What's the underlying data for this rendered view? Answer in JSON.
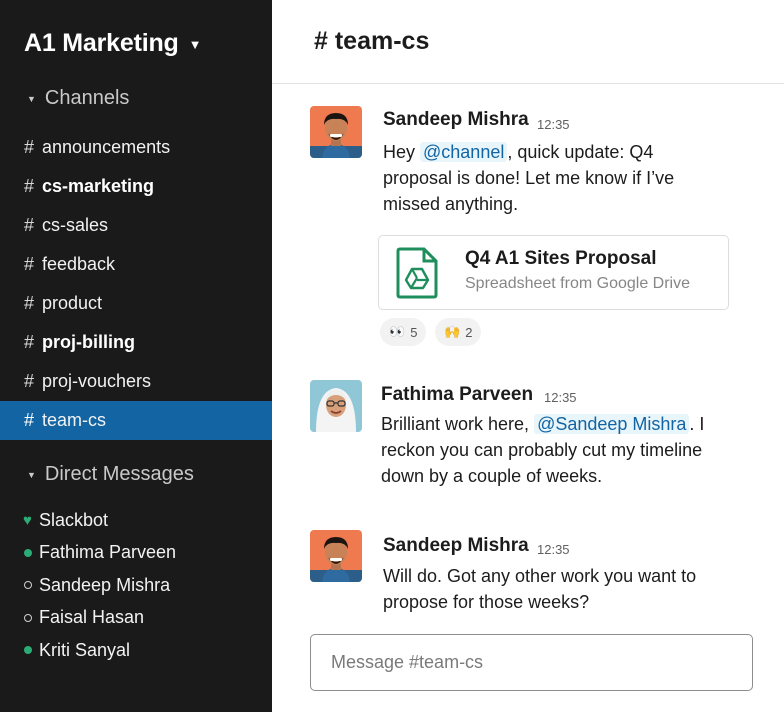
{
  "workspace": {
    "name": "A1 Marketing",
    "caret": "▼"
  },
  "sidebar": {
    "channels_heading": "Channels",
    "channels": [
      {
        "name": "announcements",
        "bold": false,
        "active": false
      },
      {
        "name": "cs-marketing",
        "bold": true,
        "active": false
      },
      {
        "name": "cs-sales",
        "bold": false,
        "active": false
      },
      {
        "name": "feedback",
        "bold": false,
        "active": false
      },
      {
        "name": "product",
        "bold": false,
        "active": false
      },
      {
        "name": "proj-billing",
        "bold": true,
        "active": false
      },
      {
        "name": "proj-vouchers",
        "bold": false,
        "active": false
      },
      {
        "name": "team-cs",
        "bold": false,
        "active": true
      }
    ],
    "dms_heading": "Direct Messages",
    "dms": [
      {
        "name": "Slackbot",
        "presence": "heart"
      },
      {
        "name": "Fathima Parveen",
        "presence": "online"
      },
      {
        "name": "Sandeep Mishra",
        "presence": "away"
      },
      {
        "name": "Faisal Hasan",
        "presence": "away"
      },
      {
        "name": "Kriti Sanyal",
        "presence": "online"
      }
    ]
  },
  "header": {
    "hash": "#",
    "channel": "team-cs"
  },
  "messages": [
    {
      "author": "Sandeep Mishra",
      "time": "12:35",
      "text_before": "Hey ",
      "mention": "@channel",
      "text_after": ", quick update: Q4 proposal is done! Let me know if I’ve missed anything.",
      "attachment": {
        "title": "Q4 A1 Sites Proposal",
        "subtitle": "Spreadsheet from Google Drive",
        "icon": "google-drive-icon"
      },
      "reactions": [
        {
          "emoji": "👀",
          "icon": "eyes-emoji",
          "count": "5"
        },
        {
          "emoji": "🙌",
          "icon": "raised-hands-emoji",
          "count": "2"
        }
      ]
    },
    {
      "author": "Fathima Parveen",
      "time": "12:35",
      "text_before": "Brilliant work here, ",
      "mention": "@Sandeep Mishra",
      "text_after": ". I reckon you can probably cut my timeline down by a couple of weeks."
    },
    {
      "author": "Sandeep Mishra",
      "time": "12:35",
      "text": "Will do. Got any other work you want to propose for those weeks?"
    }
  ],
  "composer": {
    "placeholder": "Message #team-cs"
  },
  "colors": {
    "sidebar_bg": "#1a1a1a",
    "active_channel": "#1264a3",
    "presence_online": "#2bac76",
    "mention_bg": "#e8f5fa",
    "mention_text": "#1264a3",
    "drive_green": "#1e8e5c"
  }
}
